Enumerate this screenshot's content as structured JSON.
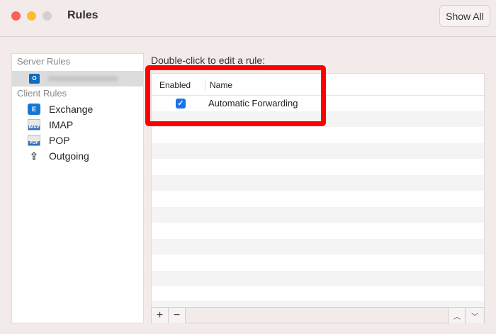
{
  "window": {
    "title": "Rules",
    "show_all_label": "Show All"
  },
  "sidebar": {
    "server_rules_label": "Server Rules",
    "client_rules_label": "Client Rules",
    "client_items": [
      {
        "label": "Exchange",
        "icon": "exchange-icon"
      },
      {
        "label": "IMAP",
        "icon": "imap-mail-icon"
      },
      {
        "label": "POP",
        "icon": "pop-mail-icon"
      },
      {
        "label": "Outgoing",
        "icon": "outgoing-icon"
      }
    ],
    "imap_badge": "IMAP",
    "pop_badge": "POP"
  },
  "main": {
    "hint": "Double-click to edit a rule:",
    "columns": {
      "enabled": "Enabled",
      "name": "Name"
    },
    "rules": [
      {
        "enabled": true,
        "name": "Automatic Forwarding"
      }
    ]
  },
  "toolbar": {
    "add": "+",
    "remove": "−",
    "up": "︿",
    "down": "﹀"
  },
  "colors": {
    "highlight": "#ff0000",
    "checkbox": "#1a73e8"
  }
}
